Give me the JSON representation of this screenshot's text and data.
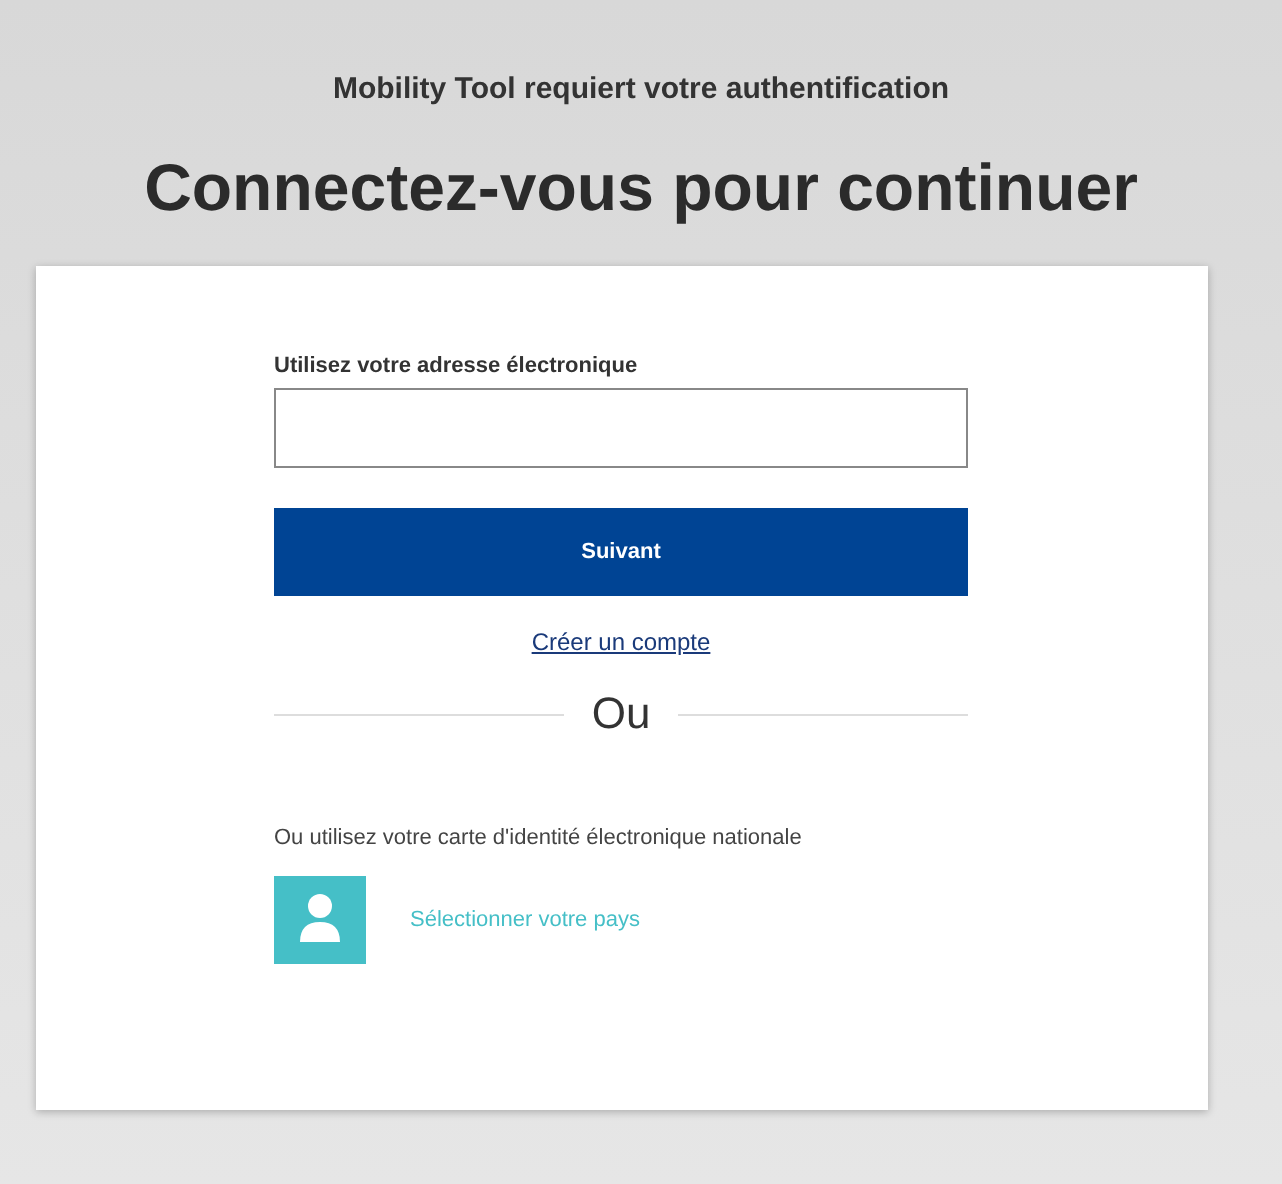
{
  "header": {
    "subtitle": "Mobility Tool requiert votre authentification",
    "title": "Connectez-vous pour continuer"
  },
  "form": {
    "email_label": "Utilisez votre adresse électronique",
    "next_button": "Suivant",
    "create_account_link": "Créer un compte",
    "separator": "Ou",
    "eid_text": "Ou utilisez votre carte d'identité électronique nationale",
    "country_link": "Sélectionner votre pays"
  }
}
